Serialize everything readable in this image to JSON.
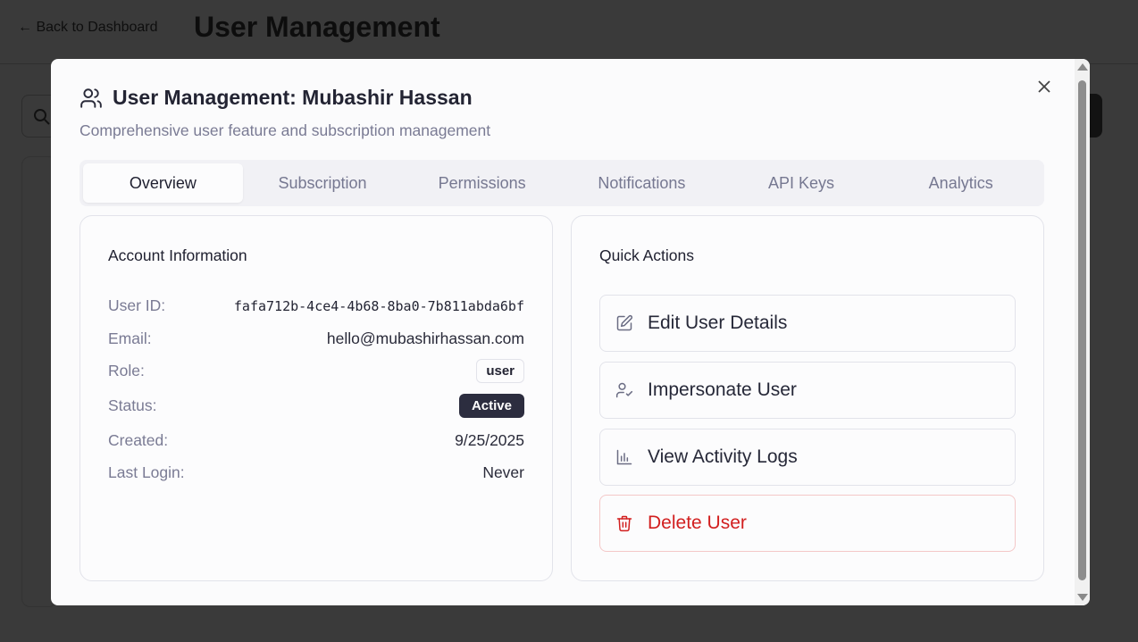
{
  "background": {
    "back_link": "← Back to Dashboard",
    "page_title": "User Management"
  },
  "modal": {
    "title": "User Management: Mubashir Hassan",
    "subtitle": "Comprehensive user feature and subscription management",
    "tabs": [
      {
        "label": "Overview",
        "active": true
      },
      {
        "label": "Subscription",
        "active": false
      },
      {
        "label": "Permissions",
        "active": false
      },
      {
        "label": "Notifications",
        "active": false
      },
      {
        "label": "API Keys",
        "active": false
      },
      {
        "label": "Analytics",
        "active": false
      }
    ],
    "account_info": {
      "title": "Account Information",
      "rows": [
        {
          "label": "User ID:",
          "value": "fafa712b-4ce4-4b68-8ba0-7b811abda6bf"
        },
        {
          "label": "Email:",
          "value": "hello@mubashirhassan.com"
        },
        {
          "label": "Role:",
          "value": "user"
        },
        {
          "label": "Status:",
          "value": "Active"
        },
        {
          "label": "Created:",
          "value": "9/25/2025"
        },
        {
          "label": "Last Login:",
          "value": "Never"
        }
      ]
    },
    "quick_actions": {
      "title": "Quick Actions",
      "items": [
        {
          "label": "Edit User Details",
          "icon": "edit-icon"
        },
        {
          "label": "Impersonate User",
          "icon": "user-check-icon"
        },
        {
          "label": "View Activity Logs",
          "icon": "bar-chart-icon"
        },
        {
          "label": "Delete User",
          "icon": "trash-icon"
        }
      ]
    }
  },
  "colors": {
    "overlay": "#3a3a3a",
    "modal_bg": "#fbfbfc",
    "status_active": "#2c2d3f",
    "danger": "#d21f1f",
    "muted_text": "#7a7b94"
  }
}
